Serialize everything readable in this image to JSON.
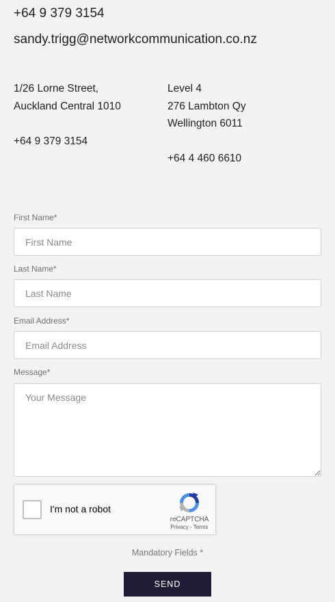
{
  "contact": {
    "phone": "+64 9 379 3154",
    "email": "sandy.trigg@networkcommunication.co.nz"
  },
  "offices": [
    {
      "address_lines": [
        "1/26 Lorne Street,",
        "Auckland Central 1010"
      ],
      "phone": "+64 9 379 3154"
    },
    {
      "address_lines": [
        "Level 4",
        "276 Lambton Qy",
        "Wellington 6011"
      ],
      "phone": "+64 4 460 6610"
    }
  ],
  "form": {
    "first_name": {
      "label": "First Name*",
      "placeholder": "First Name",
      "value": ""
    },
    "last_name": {
      "label": "Last Name*",
      "placeholder": "Last Name",
      "value": ""
    },
    "email": {
      "label": "Email Address*",
      "placeholder": "Email Address",
      "value": ""
    },
    "message": {
      "label": "Message*",
      "placeholder": "Your Message",
      "value": ""
    },
    "recaptcha": {
      "label": "I'm not a robot",
      "brand": "reCAPTCHA",
      "privacy": "Privacy",
      "separator": " - ",
      "terms": "Terms",
      "checked": false,
      "icon": "recaptcha-logo-icon"
    },
    "mandatory_note": "Mandatory Fields *",
    "send_label": "SEND"
  },
  "colors": {
    "background": "#f3f3f3",
    "button_bg": "#221d36",
    "recaptcha_blue": "#1c3aa9",
    "recaptcha_lightblue": "#4a90e2",
    "recaptcha_gray": "#b4b4b4"
  }
}
